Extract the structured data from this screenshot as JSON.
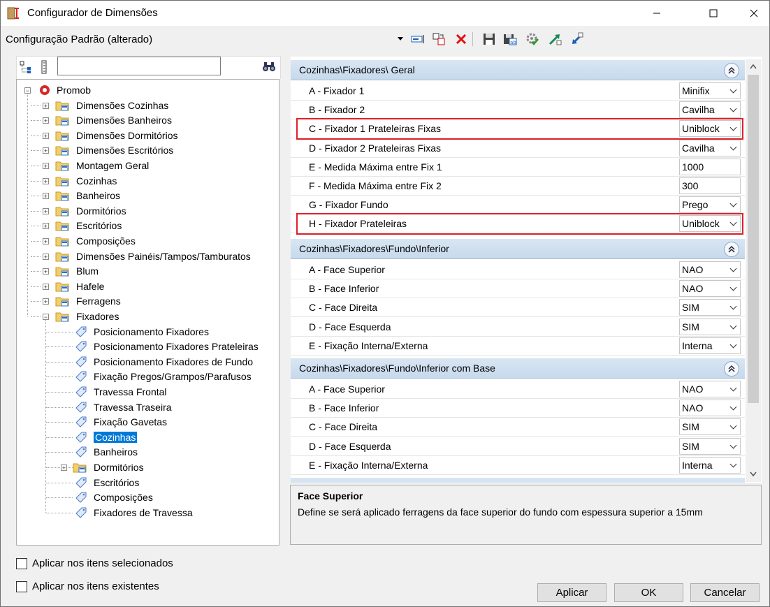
{
  "window": {
    "title": "Configurador de Dimensões"
  },
  "config": {
    "label": "Configuração Padrão (alterado)"
  },
  "search": {
    "value": ""
  },
  "tree": {
    "root": "Promob",
    "items": [
      "Dimensões Cozinhas",
      "Dimensões Banheiros",
      "Dimensões Dormitórios",
      "Dimensões Escritórios",
      "Montagem Geral",
      "Cozinhas",
      "Banheiros",
      "Dormitórios",
      "Escritórios",
      "Composições",
      "Dimensões Painéis/Tampos/Tamburatos",
      "Blum",
      "Hafele",
      "Ferragens",
      "Fixadores"
    ],
    "fixadores_children": [
      "Posicionamento Fixadores",
      "Posicionamento Fixadores Prateleiras",
      "Posicionamento Fixadores de Fundo",
      "Fixação Pregos/Grampos/Parafusos",
      "Travessa Frontal",
      "Travessa Traseira",
      "Fixação Gavetas",
      "Cozinhas",
      "Banheiros",
      "Dormitórios",
      "Escritórios",
      "Composições",
      "Fixadores de Travessa"
    ],
    "selected": "Cozinhas"
  },
  "categories": [
    {
      "title": "Cozinhas\\Fixadores\\ Geral",
      "rows": [
        {
          "name": "A - Fixador 1",
          "value": "Minifix",
          "dropdown": true
        },
        {
          "name": "B - Fixador 2",
          "value": "Cavilha",
          "dropdown": true
        },
        {
          "name": "C - Fixador 1 Prateleiras Fixas",
          "value": "Uniblock",
          "dropdown": true
        },
        {
          "name": "D - Fixador 2 Prateleiras Fixas",
          "value": "Cavilha",
          "dropdown": true
        },
        {
          "name": "E - Medida Máxima entre Fix 1",
          "value": "1000",
          "dropdown": false
        },
        {
          "name": "F - Medida Máxima entre Fix 2",
          "value": "300",
          "dropdown": false
        },
        {
          "name": "G - Fixador Fundo",
          "value": "Prego",
          "dropdown": true
        },
        {
          "name": "H - Fixador Prateleiras",
          "value": "Uniblock",
          "dropdown": true
        }
      ]
    },
    {
      "title": "Cozinhas\\Fixadores\\Fundo\\Inferior",
      "rows": [
        {
          "name": "A - Face Superior",
          "value": "NAO",
          "dropdown": true
        },
        {
          "name": "B - Face Inferior",
          "value": "NAO",
          "dropdown": true
        },
        {
          "name": "C - Face Direita",
          "value": "SIM",
          "dropdown": true
        },
        {
          "name": "D - Face Esquerda",
          "value": "SIM",
          "dropdown": true
        },
        {
          "name": "E - Fixação Interna/Externa",
          "value": "Interna",
          "dropdown": true
        }
      ]
    },
    {
      "title": "Cozinhas\\Fixadores\\Fundo\\Inferior com Base",
      "rows": [
        {
          "name": "A - Face Superior",
          "value": "NAO",
          "dropdown": true
        },
        {
          "name": "B - Face Inferior",
          "value": "NAO",
          "dropdown": true
        },
        {
          "name": "C - Face Direita",
          "value": "SIM",
          "dropdown": true
        },
        {
          "name": "D - Face Esquerda",
          "value": "SIM",
          "dropdown": true
        },
        {
          "name": "E - Fixação Interna/Externa",
          "value": "Interna",
          "dropdown": true
        }
      ]
    }
  ],
  "description": {
    "title": "Face Superior",
    "text": "Define se será aplicado ferragens da face superior do fundo com espessura superior a 15mm"
  },
  "options": {
    "apply_selected": "Aplicar nos itens selecionados",
    "apply_existing": "Aplicar nos itens existentes"
  },
  "buttons": {
    "apply": "Aplicar",
    "ok": "OK",
    "cancel": "Cancelar"
  },
  "colors": {
    "selection": "#0078d7",
    "highlight": "#e0202a",
    "category": "#c6d9ec"
  }
}
